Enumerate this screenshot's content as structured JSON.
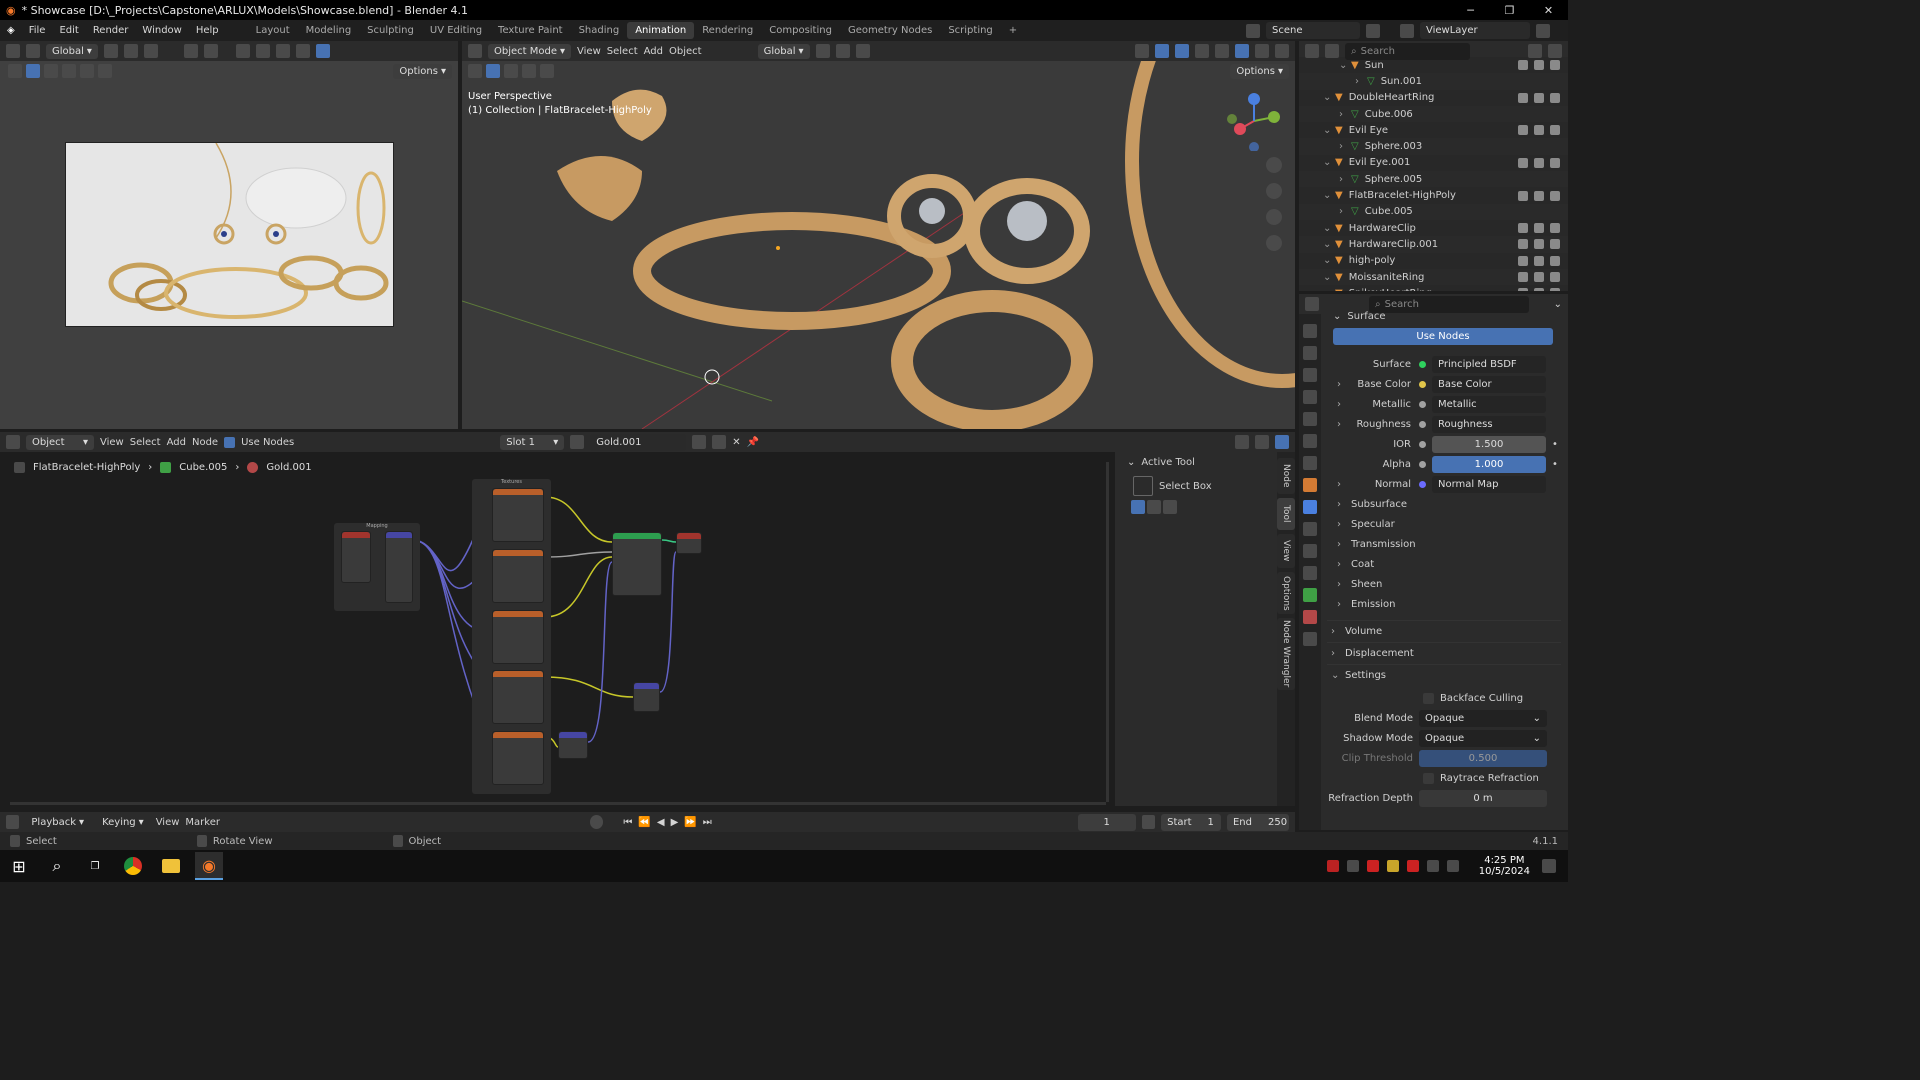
{
  "window": {
    "title": "* Showcase [D:\\_Projects\\Capstone\\ARLUX\\Models\\Showcase.blend] - Blender 4.1"
  },
  "menu": [
    "File",
    "Edit",
    "Render",
    "Window",
    "Help"
  ],
  "workspaces": [
    "Layout",
    "Modeling",
    "Sculpting",
    "UV Editing",
    "Texture Paint",
    "Shading",
    "Animation",
    "Rendering",
    "Compositing",
    "Geometry Nodes",
    "Scripting"
  ],
  "active_workspace": "Animation",
  "scene": {
    "label": "Scene",
    "view_layer": "ViewLayer"
  },
  "left_view": {
    "orientation": "Global",
    "options": "Options"
  },
  "main_view": {
    "mode": "Object Mode",
    "menus": [
      "View",
      "Select",
      "Add",
      "Object"
    ],
    "orientation": "Global",
    "options": "Options",
    "perspective": "User Perspective",
    "collection": "(1) Collection | FlatBracelet-HighPoly"
  },
  "outliner": {
    "search_placeholder": "Search",
    "items": [
      {
        "name": "Sun",
        "indent": 2,
        "type": "light"
      },
      {
        "name": "Sun.001",
        "indent": 3,
        "type": "light-data"
      },
      {
        "name": "DoubleHeartRing",
        "indent": 1,
        "type": "mesh"
      },
      {
        "name": "Cube.006",
        "indent": 2,
        "type": "mesh-data"
      },
      {
        "name": "Evil Eye",
        "indent": 1,
        "type": "mesh"
      },
      {
        "name": "Sphere.003",
        "indent": 2,
        "type": "mesh-data"
      },
      {
        "name": "Evil Eye.001",
        "indent": 1,
        "type": "mesh"
      },
      {
        "name": "Sphere.005",
        "indent": 2,
        "type": "mesh-data"
      },
      {
        "name": "FlatBracelet-HighPoly",
        "indent": 1,
        "type": "mesh"
      },
      {
        "name": "Cube.005",
        "indent": 2,
        "type": "mesh-data"
      },
      {
        "name": "HardwareClip",
        "indent": 1,
        "type": "mesh"
      },
      {
        "name": "HardwareClip.001",
        "indent": 1,
        "type": "mesh"
      },
      {
        "name": "high-poly",
        "indent": 1,
        "type": "mesh"
      },
      {
        "name": "MoissaniteRing",
        "indent": 1,
        "type": "mesh"
      },
      {
        "name": "SpikeyHeartRing",
        "indent": 1,
        "type": "mesh"
      }
    ]
  },
  "properties": {
    "search_placeholder": "Search",
    "surface_section": "Surface",
    "use_nodes": "Use Nodes",
    "rows": [
      {
        "label": "Surface",
        "value": "Principled BSDF",
        "dot": "#2fd15e",
        "kind": "link"
      },
      {
        "label": "Base Color",
        "value": "Base Color",
        "dot": "#e1c54a",
        "kind": "link",
        "expand": true
      },
      {
        "label": "Metallic",
        "value": "Metallic",
        "dot": "#a1a1a1",
        "kind": "link",
        "expand": true
      },
      {
        "label": "Roughness",
        "value": "Roughness",
        "dot": "#a1a1a1",
        "kind": "link",
        "expand": true
      },
      {
        "label": "IOR",
        "value": "1.500",
        "dot": "#a1a1a1",
        "kind": "num"
      },
      {
        "label": "Alpha",
        "value": "1.000",
        "dot": "#a1a1a1",
        "kind": "slider"
      },
      {
        "label": "Normal",
        "value": "Normal Map",
        "dot": "#6b6bff",
        "kind": "link",
        "expand": true
      }
    ],
    "subsections": [
      "Subsurface",
      "Specular",
      "Transmission",
      "Coat",
      "Sheen",
      "Emission"
    ],
    "sections": [
      "Volume",
      "Displacement",
      "Settings"
    ],
    "backface_culling": "Backface Culling",
    "blend_mode": {
      "label": "Blend Mode",
      "value": "Opaque"
    },
    "shadow_mode": {
      "label": "Shadow Mode",
      "value": "Opaque"
    },
    "clip_threshold": {
      "label": "Clip Threshold",
      "value": "0.500"
    },
    "raytrace_refraction": "Raytrace Refraction",
    "refraction_depth": {
      "label": "Refraction Depth",
      "value": "0 m"
    }
  },
  "node_editor": {
    "editor_type": "Object",
    "menus": [
      "View",
      "Select",
      "Add",
      "Node"
    ],
    "use_nodes": "Use Nodes",
    "slot": "Slot 1",
    "material": "Gold.001",
    "breadcrumb": [
      "FlatBracelet-HighPoly",
      "Cube.005",
      "Gold.001"
    ],
    "frame_mapping": "Mapping",
    "frame_textures": "Textures"
  },
  "sidebar_tabs": [
    "Node",
    "Tool",
    "View",
    "Options",
    "Node Wrangler"
  ],
  "active_tool": {
    "title": "Active Tool",
    "tool": "Select Box"
  },
  "timeline": {
    "menus": [
      "Playback",
      "Keying",
      "View",
      "Marker"
    ],
    "frame": "1",
    "start_label": "Start",
    "start": "1",
    "end_label": "End",
    "end": "250"
  },
  "statusbar": {
    "select": "Select",
    "rotate": "Rotate View",
    "object": "Object",
    "version": "4.1.1"
  },
  "taskbar": {
    "time": "4:25 PM",
    "date": "10/5/2024"
  }
}
